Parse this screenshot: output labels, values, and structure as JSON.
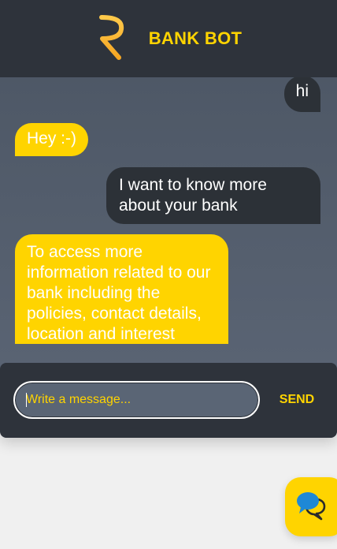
{
  "header": {
    "logo_icon": "rupee-icon",
    "title": "BANK BOT"
  },
  "messages": [
    {
      "sender": "user",
      "text": "hi"
    },
    {
      "sender": "bot",
      "text": "Hey :-)"
    },
    {
      "sender": "user",
      "text": "I want to know more about your bank"
    },
    {
      "sender": "bot",
      "text": "To access more information related to our bank including the policies, contact details, location and interest"
    }
  ],
  "composer": {
    "placeholder": "Write a message...",
    "value": "",
    "send_label": "SEND"
  },
  "launcher": {
    "icon": "chat-bubbles-icon"
  },
  "colors": {
    "accent": "#ffd400",
    "header_bg": "#2e333b",
    "user_bubble": "#2c3137",
    "bot_bubble": "#ffd400"
  }
}
